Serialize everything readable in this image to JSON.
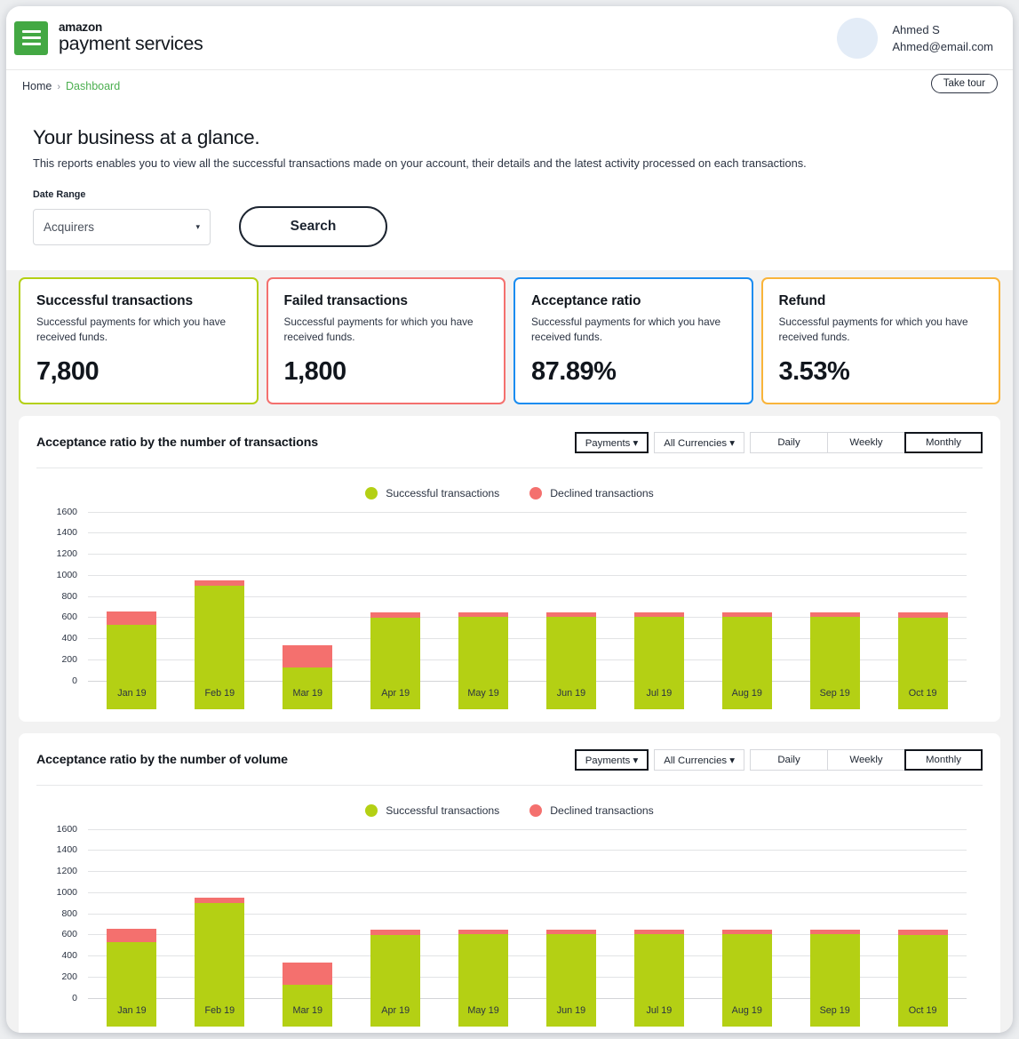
{
  "header": {
    "logo_line1": "amazon",
    "logo_line2": "payment services",
    "user_name": "Ahmed S",
    "user_email": "Ahmed@email.com"
  },
  "breadcrumb": {
    "home": "Home",
    "separator": "›",
    "current": "Dashboard",
    "take_tour": "Take tour"
  },
  "glance": {
    "title": "Your business at a glance.",
    "subtitle": "This reports enables you to view all the successful transactions made on your account, their details and the latest activity processed on each transactions.",
    "date_range_label": "Date Range",
    "date_range_value": "Acquirers",
    "caret": "▾",
    "search_label": "Search"
  },
  "kpis": [
    {
      "title": "Successful transactions",
      "desc": "Successful payments for which you have received funds.",
      "value": "7,800",
      "color": "#b4d014"
    },
    {
      "title": "Failed transactions",
      "desc": "Successful payments for which you have received funds.",
      "value": "1,800",
      "color": "#f4706e"
    },
    {
      "title": "Acceptance ratio",
      "desc": "Successful payments for which you have received funds.",
      "value": "87.89%",
      "color": "#1a8cf0"
    },
    {
      "title": "Refund",
      "desc": "Successful payments for which you have received funds.",
      "value": "3.53%",
      "color": "#f9b43a"
    }
  ],
  "charts": [
    {
      "title": "Acceptance ratio by the number of transactions",
      "controls": {
        "payments": "Payments ▾",
        "currencies": "All Currencies ▾",
        "daily": "Daily",
        "weekly": "Weekly",
        "monthly": "Monthly",
        "selected": "Monthly"
      },
      "legend": [
        {
          "label": "Successful transactions",
          "color": "#b4d014"
        },
        {
          "label": "Declined transactions",
          "color": "#f4706e"
        }
      ]
    },
    {
      "title": "Acceptance ratio by the number of volume",
      "controls": {
        "payments": "Payments ▾",
        "currencies": "All Currencies ▾",
        "daily": "Daily",
        "weekly": "Weekly",
        "monthly": "Monthly",
        "selected": "Monthly"
      },
      "legend": [
        {
          "label": "Successful transactions",
          "color": "#b4d014"
        },
        {
          "label": "Declined transactions",
          "color": "#f4706e"
        }
      ]
    }
  ],
  "chart_data": [
    {
      "type": "bar",
      "stacked": true,
      "title": "Acceptance ratio by the number of transactions",
      "xlabel": "",
      "ylabel": "",
      "ylim": [
        0,
        1600
      ],
      "yticks": [
        0,
        200,
        400,
        600,
        800,
        1000,
        1200,
        1400,
        1600
      ],
      "grid": true,
      "legend_position": "top-center",
      "categories": [
        "Jan 19",
        "Feb 19",
        "Mar 19",
        "Apr 19",
        "May 19",
        "Jun 19",
        "Jul 19",
        "Aug 19",
        "Sep 19",
        "Oct 19"
      ],
      "series": [
        {
          "name": "Successful transactions",
          "color": "#b4d014",
          "values": [
            800,
            1170,
            395,
            860,
            870,
            870,
            870,
            870,
            870,
            865
          ]
        },
        {
          "name": "Declined transactions",
          "color": "#f4706e",
          "values": [
            120,
            45,
            205,
            50,
            45,
            45,
            45,
            45,
            45,
            45
          ]
        }
      ],
      "totals": [
        920,
        1215,
        600,
        910,
        915,
        915,
        915,
        915,
        915,
        910
      ]
    },
    {
      "type": "bar",
      "stacked": true,
      "title": "Acceptance ratio by the number of volume",
      "xlabel": "",
      "ylabel": "",
      "ylim": [
        0,
        1600
      ],
      "yticks": [
        0,
        200,
        400,
        600,
        800,
        1000,
        1200,
        1400,
        1600
      ],
      "grid": true,
      "legend_position": "top-center",
      "categories": [
        "Jan 19",
        "Feb 19",
        "Mar 19",
        "Apr 19",
        "May 19",
        "Jun 19",
        "Jul 19",
        "Aug 19",
        "Sep 19",
        "Oct 19"
      ],
      "series": [
        {
          "name": "Successful transactions",
          "color": "#b4d014",
          "values": [
            800,
            1170,
            395,
            860,
            870,
            870,
            870,
            870,
            870,
            865
          ]
        },
        {
          "name": "Declined transactions",
          "color": "#f4706e",
          "values": [
            120,
            45,
            205,
            50,
            45,
            45,
            45,
            45,
            45,
            45
          ]
        }
      ],
      "totals": [
        920,
        1215,
        600,
        910,
        915,
        915,
        915,
        915,
        915,
        910
      ]
    }
  ]
}
